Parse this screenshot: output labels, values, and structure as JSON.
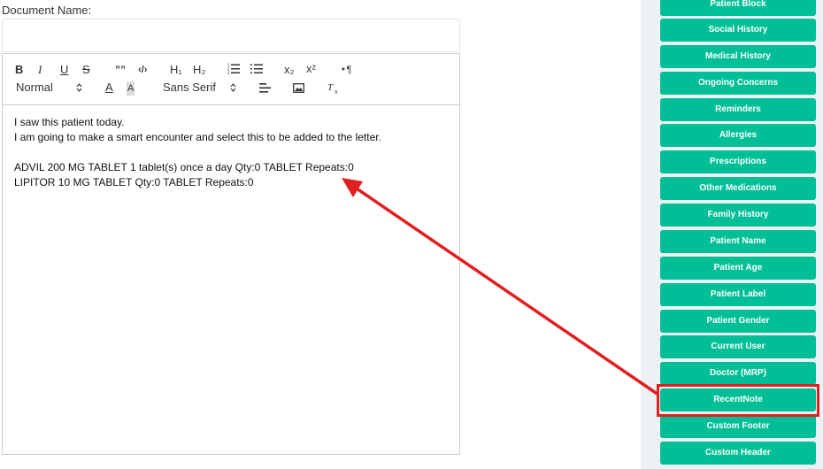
{
  "document": {
    "label": "Document Name:",
    "value": "",
    "placeholder": ""
  },
  "toolbar": {
    "bold": "B",
    "italic": "I",
    "underline": "U",
    "strike": "S",
    "blockquote": "””",
    "code": "‹/›",
    "h1": "H₁",
    "h2": "H₂",
    "subscript": "x₂",
    "superscript": "x²",
    "direction": "‣¶",
    "format_value": "Normal",
    "color": "A",
    "background": "A",
    "font_value": "Sans Serif"
  },
  "editor": {
    "lines": [
      "I saw this patient today.",
      "I am going to make a smart encounter and select this to be added to the letter.",
      "",
      "ADVIL 200 MG TABLET 1 tablet(s) once a day  Qty:0 TABLET Repeats:0",
      "LIPITOR 10 MG TABLET  Qty:0 TABLET Repeats:0"
    ]
  },
  "sidebar": {
    "buttons": [
      "Patient Block",
      "Social History",
      "Medical History",
      "Ongoing Concerns",
      "Reminders",
      "Allergies",
      "Prescriptions",
      "Other Medications",
      "Family History",
      "Patient Name",
      "Patient Age",
      "Patient Label",
      "Patient Gender",
      "Current User",
      "Doctor (MRP)",
      "RecentNote",
      "Custom Footer",
      "Custom Header"
    ],
    "highlighted": "RecentNote"
  },
  "colors": {
    "button_green": "#00bf96",
    "highlight_red": "#e02020",
    "sidebar_bg": "#eef1f4"
  }
}
